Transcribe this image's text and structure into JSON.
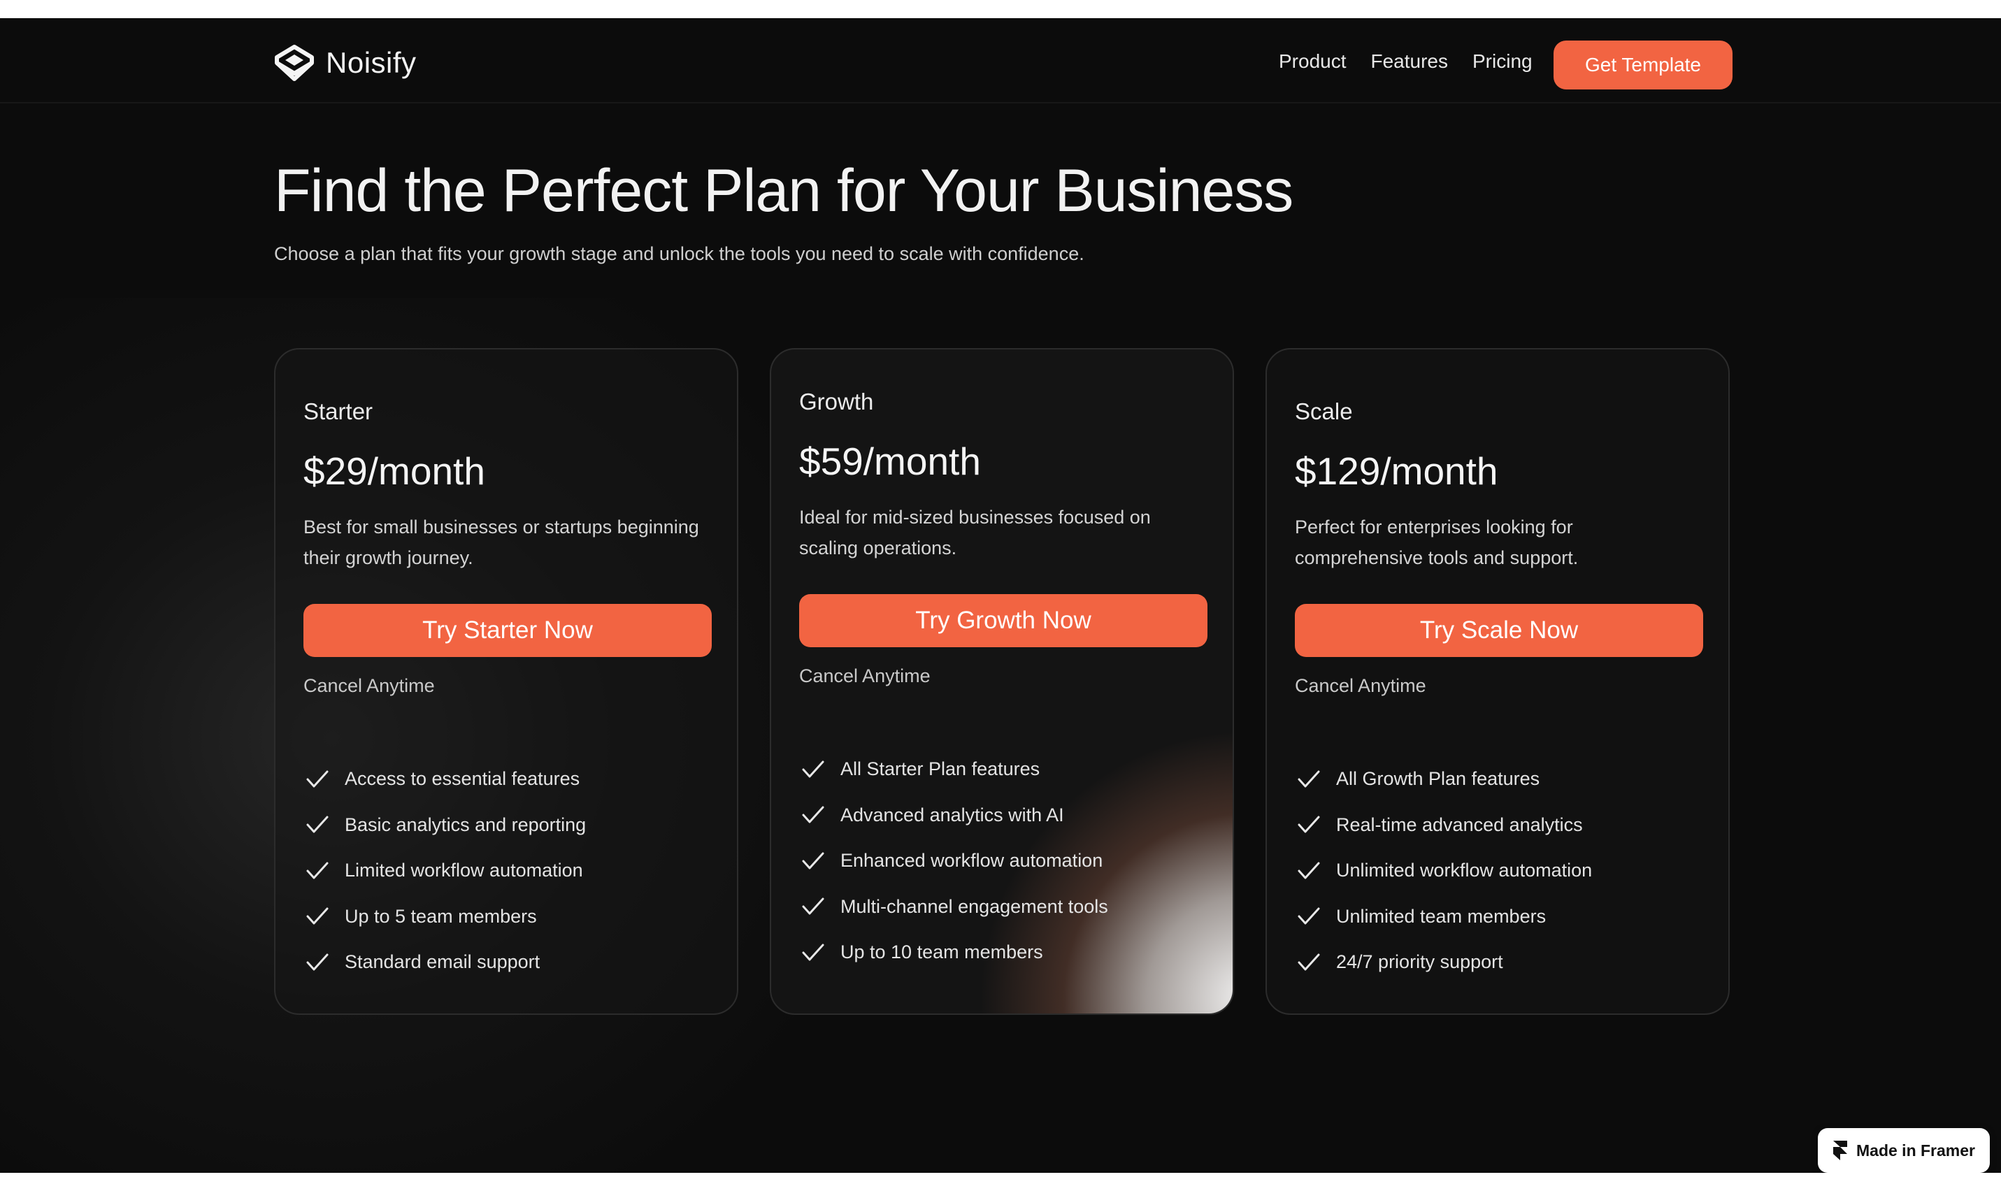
{
  "brand": {
    "name": "Noisify",
    "logo_icon": "cube-logo-icon"
  },
  "nav": {
    "links": [
      "Product",
      "Features",
      "Pricing"
    ],
    "cta_label": "Get Template"
  },
  "hero": {
    "title": "Find the Perfect Plan for Your Business",
    "subtitle": "Choose a plan that fits your growth stage and unlock the tools you need to scale with confidence."
  },
  "plans": [
    {
      "name": "Starter",
      "price": "$29/month",
      "description": "Best for small businesses or startups beginning their growth journey.",
      "button_label": "Try Starter Now",
      "note": "Cancel Anytime",
      "features": [
        "Access to essential features",
        "Basic analytics and reporting",
        "Limited workflow automation",
        "Up to 5 team members",
        "Standard email support"
      ]
    },
    {
      "name": "Growth",
      "price": "$59/month",
      "description": "Ideal for mid-sized businesses focused on scaling operations.",
      "button_label": "Try Growth Now",
      "note": "Cancel Anytime",
      "features": [
        "All Starter Plan features",
        "Advanced analytics with AI",
        "Enhanced workflow automation",
        "Multi-channel engagement tools",
        "Up to 10 team members"
      ]
    },
    {
      "name": "Scale",
      "price": "$129/month",
      "description": "Perfect for enterprises looking for comprehensive tools and support.",
      "button_label": "Try Scale Now",
      "note": "Cancel Anytime",
      "features": [
        "All Growth Plan features",
        "Real-time advanced analytics",
        "Unlimited workflow automation",
        "Unlimited team members",
        "24/7 priority support"
      ]
    }
  ],
  "badge": {
    "label": "Made in Framer",
    "icon": "framer-icon"
  },
  "colors": {
    "accent": "#f26442",
    "background": "#0c0c0c",
    "text": "#f2f2f2",
    "card_border": "#2c2c2c"
  }
}
